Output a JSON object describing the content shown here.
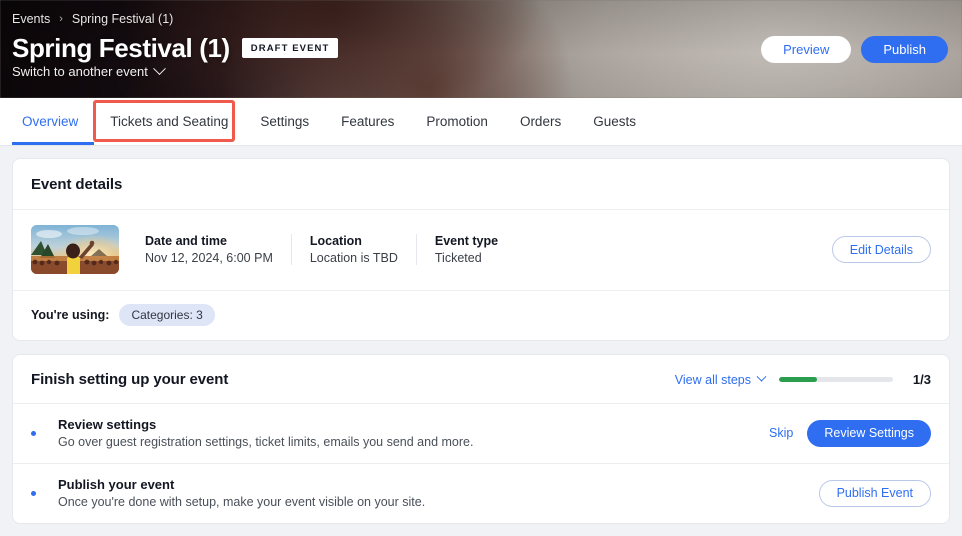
{
  "header": {
    "breadcrumb": {
      "root": "Events",
      "separator": "›",
      "current": "Spring Festival (1)"
    },
    "title": "Spring Festival (1)",
    "status_badge": "DRAFT EVENT",
    "switch_event": "Switch to another event",
    "preview_button": "Preview",
    "publish_button": "Publish",
    "accent_color": "#2f6ef0"
  },
  "tabs": {
    "items": [
      {
        "label": "Overview",
        "active": true
      },
      {
        "label": "Tickets and Seating",
        "active": false
      },
      {
        "label": "Settings",
        "active": false
      },
      {
        "label": "Features",
        "active": false
      },
      {
        "label": "Promotion",
        "active": false
      },
      {
        "label": "Orders",
        "active": false
      },
      {
        "label": "Guests",
        "active": false
      }
    ],
    "highlight_target": "Tickets and Seating",
    "highlight_color": "#ef5a4c"
  },
  "event_details": {
    "title": "Event details",
    "thumbnail_alt": "festival-crowd-sunset-photo",
    "fields": [
      {
        "label": "Date and time",
        "value": "Nov 12, 2024, 6:00 PM"
      },
      {
        "label": "Location",
        "value": "Location is TBD"
      },
      {
        "label": "Event type",
        "value": "Ticketed"
      }
    ],
    "edit_button": "Edit Details",
    "using_label": "You're using:",
    "chips": [
      "Categories: 3"
    ]
  },
  "setup": {
    "title": "Finish setting up your event",
    "view_all_steps": "View all steps",
    "progress_count": "1/3",
    "progress_percent": 33,
    "progress_color": "#2a9d4e",
    "tasks": [
      {
        "title": "Review settings",
        "description": "Go over guest registration settings, ticket limits, emails you send and more.",
        "skip_label": "Skip",
        "action_label": "Review Settings",
        "action_style": "primary"
      },
      {
        "title": "Publish your event",
        "description": "Once you're done with setup, make your event visible on your site.",
        "skip_label": "",
        "action_label": "Publish Event",
        "action_style": "outline"
      }
    ]
  }
}
